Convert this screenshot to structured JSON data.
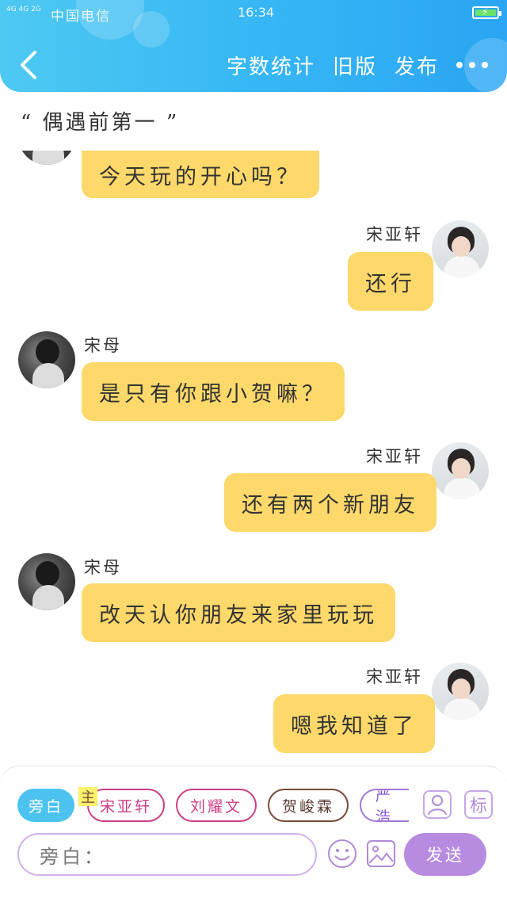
{
  "status_bar": {
    "network": "4G 4G 2G",
    "carrier": "中国电信",
    "time": "16:34",
    "battery_icon": "battery-charging-icon"
  },
  "header": {
    "back_icon": "chevron-left-icon",
    "actions": [
      "字数统计",
      "旧版",
      "发布"
    ],
    "more_icon": "more-horizontal-icon",
    "gradient": [
      "#4ec9f2",
      "#2aa5f3"
    ]
  },
  "story": {
    "title": "“ 偶遇前第一 ”"
  },
  "messages": [
    {
      "side": "left",
      "speaker": "",
      "text": "今天玩的开心吗？"
    },
    {
      "side": "right",
      "speaker": "宋亚轩",
      "text": "还行"
    },
    {
      "side": "left",
      "speaker": "宋母",
      "text": "是只有你跟小贺嘛？"
    },
    {
      "side": "right",
      "speaker": "宋亚轩",
      "text": "还有两个新朋友"
    },
    {
      "side": "left",
      "speaker": "宋母",
      "text": "改天认你朋友来家里玩玩"
    },
    {
      "side": "right",
      "speaker": "宋亚轩",
      "text": "嗯我知道了"
    }
  ],
  "composer": {
    "chips": [
      {
        "label": "旁白",
        "active": true
      },
      {
        "label": "宋亚轩",
        "active": false
      },
      {
        "label": "刘耀文",
        "active": false
      },
      {
        "label": "贺峻霖",
        "active": false
      },
      {
        "label": "严浩",
        "active": false
      }
    ],
    "main_badge": "主",
    "role_icon": "person-icon",
    "tag_label": "标",
    "input_text": "旁白：",
    "emoji_icon": "smile-icon",
    "image_icon": "image-icon",
    "send_label": "发送"
  },
  "colors": {
    "bubble": "#fdd86a",
    "accent_blue": "#4cc3ef",
    "accent_purple": "#b68be0"
  }
}
